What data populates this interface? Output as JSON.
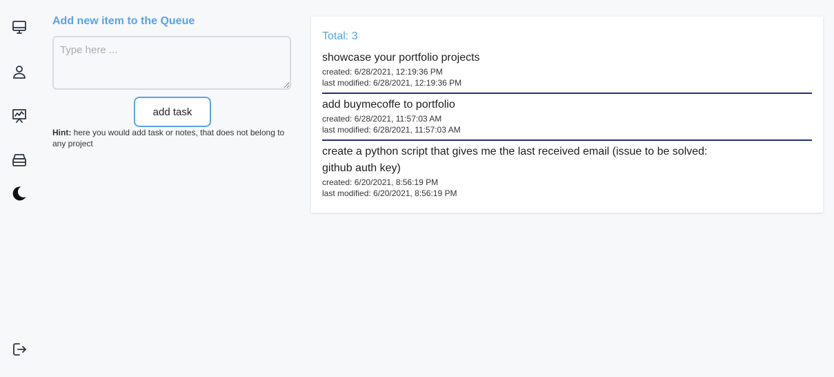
{
  "sidebar": {
    "items": [
      {
        "icon": "monitor-icon",
        "name": "sidebar-item-dashboard"
      },
      {
        "icon": "user-icon",
        "name": "sidebar-item-profile"
      },
      {
        "icon": "presentation-chart-icon",
        "name": "sidebar-item-projects"
      },
      {
        "icon": "archive-icon",
        "name": "sidebar-item-archive"
      },
      {
        "icon": "moon-icon",
        "name": "theme-toggle"
      }
    ],
    "bottom_icon": "logout-icon"
  },
  "form": {
    "title": "Add new item to the Queue",
    "input_placeholder": "Type here ...",
    "input_value": "",
    "button_label": "add task",
    "hint_label": "Hint:",
    "hint_text": "here you would add task or notes, that does not belong to any project"
  },
  "queue": {
    "total_label": "Total: 3",
    "tasks": [
      {
        "title": "showcase your portfolio projects",
        "created": "created: 6/28/2021, 12:19:36 PM",
        "modified": "last modified: 6/28/2021, 12:19:36 PM"
      },
      {
        "title": "add buymecoffe to portfolio",
        "created": "created: 6/28/2021, 11:57:03 AM",
        "modified": "last modified: 6/28/2021, 11:57:03 AM"
      },
      {
        "title": "create a python script that gives me the last received email (issue to be solved: github auth key)",
        "created": "created: 6/20/2021, 8:56:19 PM",
        "modified": "last modified: 6/20/2021, 8:56:19 PM"
      }
    ]
  },
  "colors": {
    "accent": "#5aa3e6",
    "divider": "#1f2f7a",
    "background": "#f7f8fa"
  }
}
